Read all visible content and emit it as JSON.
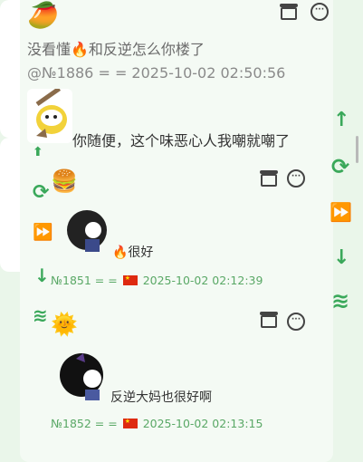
{
  "main_post": {
    "text": "没看懂🔥和反逆怎么你楼了",
    "meta": "@№1886 = = 2025-10-02 02:50:56",
    "comment": "你随便，这个味恶心人我嘲就嘲了"
  },
  "reply1": {
    "text": "🔥很好",
    "id": "№1851 = =",
    "time": "2025-10-02 02:12:39"
  },
  "reply2": {
    "text": "反逆大妈也很好啊",
    "id": "№1852 = =",
    "time": "2025-10-02 02:13:15"
  },
  "icons": {
    "mango": "mango-emoji",
    "burger": "burger-emoji",
    "sun": "sun-emoji",
    "gift": "gift-icon",
    "chat": "chat-icon"
  },
  "side_actions": [
    "arrow-up",
    "refresh",
    "fast-forward",
    "arrow-down",
    "layers"
  ],
  "colors": {
    "accent": "#3aa85a",
    "background": "#eaf6ea"
  }
}
